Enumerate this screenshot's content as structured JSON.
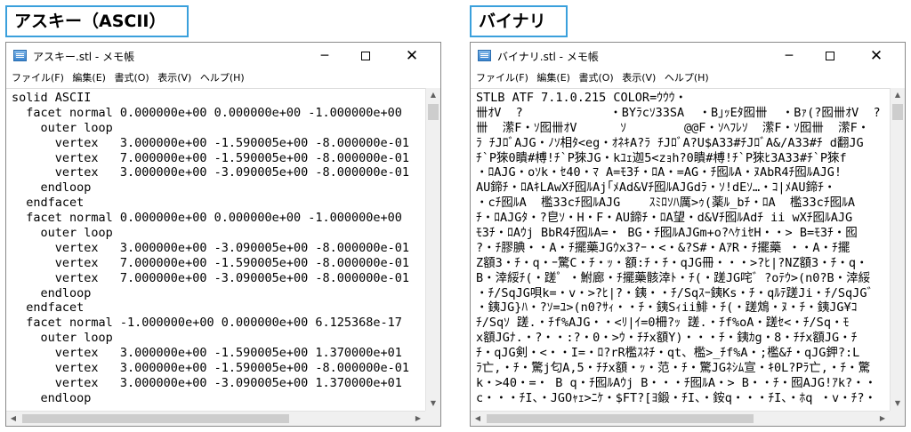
{
  "headings": {
    "ascii": "アスキー（ASCII）",
    "binary": "バイナリー"
  },
  "windows": {
    "ascii": {
      "title": "アスキー.stl - メモ帳",
      "menu": [
        "ファイル(F)",
        "編集(E)",
        "書式(O)",
        "表示(V)",
        "ヘルプ(H)"
      ],
      "lines": [
        "solid ASCII",
        "  facet normal 0.000000e+00 0.000000e+00 -1.000000e+00",
        "    outer loop",
        "      vertex   3.000000e+00 -1.590005e+00 -8.000000e-01",
        "      vertex   7.000000e+00 -1.590005e+00 -8.000000e-01",
        "      vertex   3.000000e+00 -3.090005e+00 -8.000000e-01",
        "    endloop",
        "  endfacet",
        "  facet normal 0.000000e+00 0.000000e+00 -1.000000e+00",
        "    outer loop",
        "      vertex   3.000000e+00 -3.090005e+00 -8.000000e-01",
        "      vertex   7.000000e+00 -1.590005e+00 -8.000000e-01",
        "      vertex   7.000000e+00 -3.090005e+00 -8.000000e-01",
        "    endloop",
        "  endfacet",
        "  facet normal -1.000000e+00 0.000000e+00 6.125368e-17",
        "    outer loop",
        "      vertex   3.000000e+00 -1.590005e+00 1.370000e+01",
        "      vertex   3.000000e+00 -1.590005e+00 -8.000000e-01",
        "      vertex   3.000000e+00 -3.090005e+00 1.370000e+01",
        "    endloop"
      ]
    },
    "binary": {
      "title": "バイナリ.stl - メモ帳",
      "menu": [
        "ファイル(F)",
        "編集(E)",
        "書式(O)",
        "表示(V)",
        "ヘルプ(H)"
      ],
      "lines": [
        "STLB ATF 7.1.0.215 COLOR=ｳｳｳ・",
        "卌ｵV  ?            ・BYﾗcｿ33SA  ・B｣ｯEﾀ囮卌  ・Bｧ(?囮卌ｵV  ?",
        "卌  潆F・ｿ囮卌ｵV      ｿ        @@F・ｿﾍﾌﾚｿ  潆F・ｿ囮卌  潆F・",
        "ﾗ ﾁJﾛﾞAJG・ﾉｿ相ﾀ<eg・ｵﾈｷA?ﾗ ﾁJﾛﾞA?U$A33#ﾁJﾛﾞA&/A33#ﾁ d翻JG",
        "ﾁ`P猍0瞶#榑!ﾁ`P猍JG・kﾕｪ迦5<zｮh?0瞶#榑!ﾁ`P猍ﾋ3A33#ﾁ`P猍f",
        "・ﾛAJG・oｿk・ｾ40・ﾏ A=ﾓ3ﾁ・ﾛA・=AG・ﾁ囮ﾙA・ﾇAbR4ﾁ囮ﾙAJG!",
        "AU鍗ﾁ・ﾛAｷLAwXﾁ囮ﾙAj｢ﾒAd&Vﾁ囮ﾙAJGdﾗ・ｿ!dEｿ…・ｺ|ﾒAU鍗ﾁ・",
        "・cﾁ囮ﾙA  檻33cﾁ囮ﾙAJG    ｽﾐﾛｿﾊ厲>ｩ(薬ﾙ_bﾁ・ﾛA  檻33cﾁ囮ﾙA",
        "ﾁ・ﾛAJGﾀ・?皀ｿ・H・F・AU鍗ﾁ・ﾛA望・d&Vﾁ囮ﾙAdﾁ ii wXﾁ囮ﾙAJG",
        "ﾓ3ﾁ・ﾛAｳj BbR4ﾁ囮ﾙA=・ BG・ﾁ囮ﾙAJGm+o?ﾍｹiｾH・・> B=ﾓ3ﾁ・囮",
        "?・ﾁ膠腆・・A・ﾁ擺藥JGｳx3?ｰ・<・&?S#・AｱR・ﾁ擺藥 ・・A・ﾁ擺",
        "Z額3・ﾁ・q・ｰ驚C・ﾁ・ｯ・額:ﾁ・ﾁ・qJG冊・・・>?ﾋ|?NZ額3・ﾁ・q・",
        "B・涬綏ﾁ(・蹉゜・鮒廊・ﾁ擺藥骸涬ﾄ・ﾁ(・蹉JG咤゛?oﾃｳ>(n0?B・涬綏",
        "・ﾁ/SqJG唄k=・v・>?ﾋ|?・銕・・ﾁ/Sqｽｰ銕Ks・ﾁ・qﾙﾃ蹉Ji・ﾁ/SqJG゛",
        "・銕JG}ﾊ・?ｿ=ﾕ>(n0?ｻｨ・・ﾁ・銕Sｨii鯡・ﾁ(・蹉鴆・ﾇ・ﾁ・銕JG¥ｺ",
        "ﾁ/Sqｿ 蹉.・ﾁf%AJG・・<ﾘ|ｲ=0柵?ｯ 蹉.・ﾁf%oA・蹉ｾ<・ﾁ/Sq・ﾓ",
        "x額JGﾅ.・?・・:?・0・>ｳ・ﾁﾁx額Y)・・・ﾁ・銕ｶg・8・ﾁﾁx額JG・ﾁ",
        "ﾁ・qJG剣・<・・I=・ﾛ?rR檻ｽﾈﾁ・qt、檻>_ﾁf%A・;檻&ﾁ・qJG鉀?:L",
        "ﾗ亡,・ﾁ・驚j匂A,5・ﾁﾁx額・ｯ・范・ﾁ・驚JGﾈｼﾑ宣・ｷ0L?Pﾗ亡,・ﾁ・驚",
        "k・>40・=・ B q・ﾁ囮ﾙAｳj B・・・ﾁ囮ﾙA・> B・・ﾁ・囮AJG!ｱk?・・",
        "c・・・ﾁI、・JGOｬｪ>ﾆｹ・$FT?[ﾖ鍛・ﾁI、・銨q・・・ﾁI、・ﾎq ・v・ﾁ?・"
      ]
    }
  }
}
